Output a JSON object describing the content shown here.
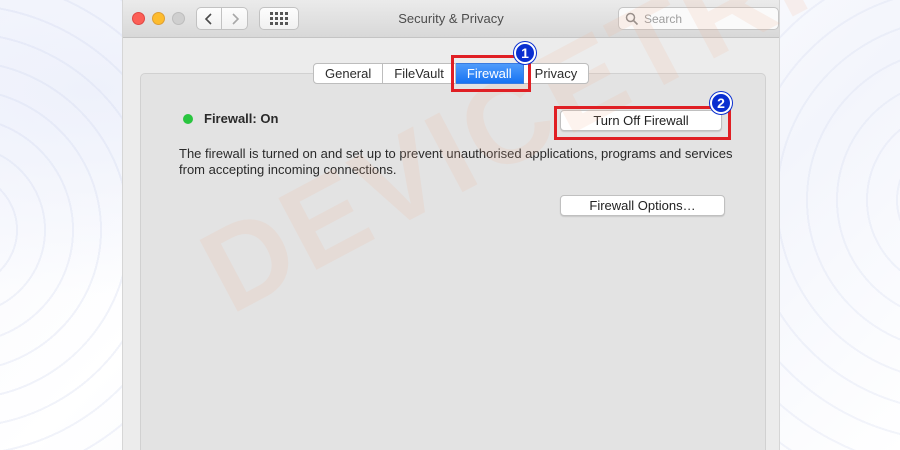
{
  "window": {
    "title": "Security & Privacy",
    "search_placeholder": "Search"
  },
  "tabs": [
    {
      "label": "General",
      "active": false
    },
    {
      "label": "FileVault",
      "active": false
    },
    {
      "label": "Firewall",
      "active": true
    },
    {
      "label": "Privacy",
      "active": false
    }
  ],
  "firewall": {
    "status": "Firewall: On",
    "status_color": "#29c53f",
    "description": "The firewall is turned on and set up to prevent unauthorised applications, programs and services from accepting incoming connections.",
    "turn_off_label": "Turn Off Firewall",
    "options_label": "Firewall Options…"
  },
  "annotations": {
    "step1": "1",
    "step2": "2",
    "highlight_color": "#e01f24",
    "badge_color": "#0a2fd0"
  },
  "watermark": "DEVICETRICKS"
}
